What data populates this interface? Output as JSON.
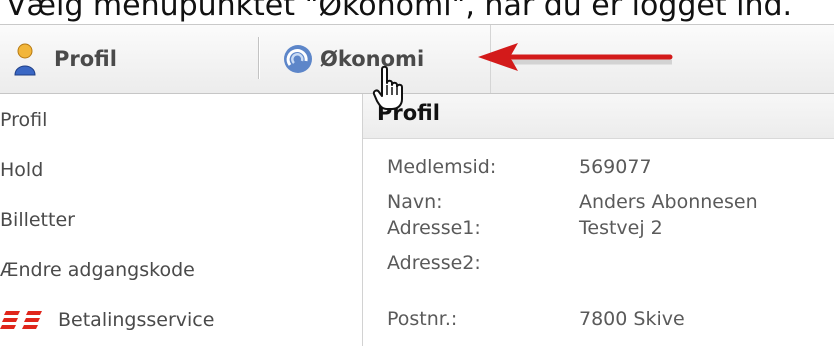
{
  "caption": "Vælg menupunktet \"Økonomi\", når du er logget ind.",
  "toolbar": {
    "profil_label": "Profil",
    "okonomi_label": "Økonomi"
  },
  "icons": {
    "profil": "person-icon",
    "okonomi": "swirl-icon",
    "arrow": "red-arrow-annotation",
    "cursor": "hand-cursor-icon",
    "betalingsservice": "betalingsservice-logo"
  },
  "colors": {
    "annotation_red": "#d31a1a",
    "bs_logo_red": "#e0261b"
  },
  "sidebar": {
    "items": [
      {
        "label": "Profil"
      },
      {
        "label": "Hold"
      },
      {
        "label": "Billetter"
      },
      {
        "label": "Ændre adgangskode"
      },
      {
        "label": "Betalingsservice"
      }
    ]
  },
  "main": {
    "title": "Profil",
    "fields": [
      {
        "label": "Medlemsid:",
        "value": "569077"
      },
      {
        "label": "Navn:",
        "value": "Anders Abonnesen"
      },
      {
        "label": "Adresse1:",
        "value": "Testvej 2"
      },
      {
        "label": "Adresse2:",
        "value": ""
      },
      {
        "label": "Postnr.:",
        "value": "7800 Skive"
      }
    ]
  }
}
